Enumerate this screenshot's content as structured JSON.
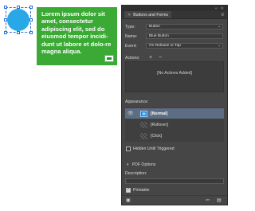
{
  "canvas": {
    "green_text": "Lorem ipsum dolor sit amet, consectetur adipiscing elit, sed do eiusmod tempor incidi-dunt ut labore et dolo-re magna aliqua."
  },
  "panel": {
    "tab_title": "Buttons and Forms",
    "type_label": "Type:",
    "type_value": "Button",
    "name_label": "Name:",
    "name_value": "Blue Button",
    "event_label": "Event:",
    "event_value": "On Release or Tap",
    "actions_label": "Actions:",
    "actions_empty": "[No Actions Added]",
    "appearance_label": "Appearance:",
    "appearance_states": [
      {
        "label": "[Normal]",
        "selected": true
      },
      {
        "label": "[Rollover]",
        "selected": false
      },
      {
        "label": "[Click]",
        "selected": false
      }
    ],
    "hidden_label": "Hidden Until Triggered",
    "pdf_options_label": "PDF Options",
    "description_label": "Description:",
    "printable_label": "Printable"
  },
  "colors": {
    "blue_fill": "#28a8e6",
    "green_box": "#3aaa35",
    "panel_bg": "#464646",
    "selection": "#5d6d84"
  }
}
